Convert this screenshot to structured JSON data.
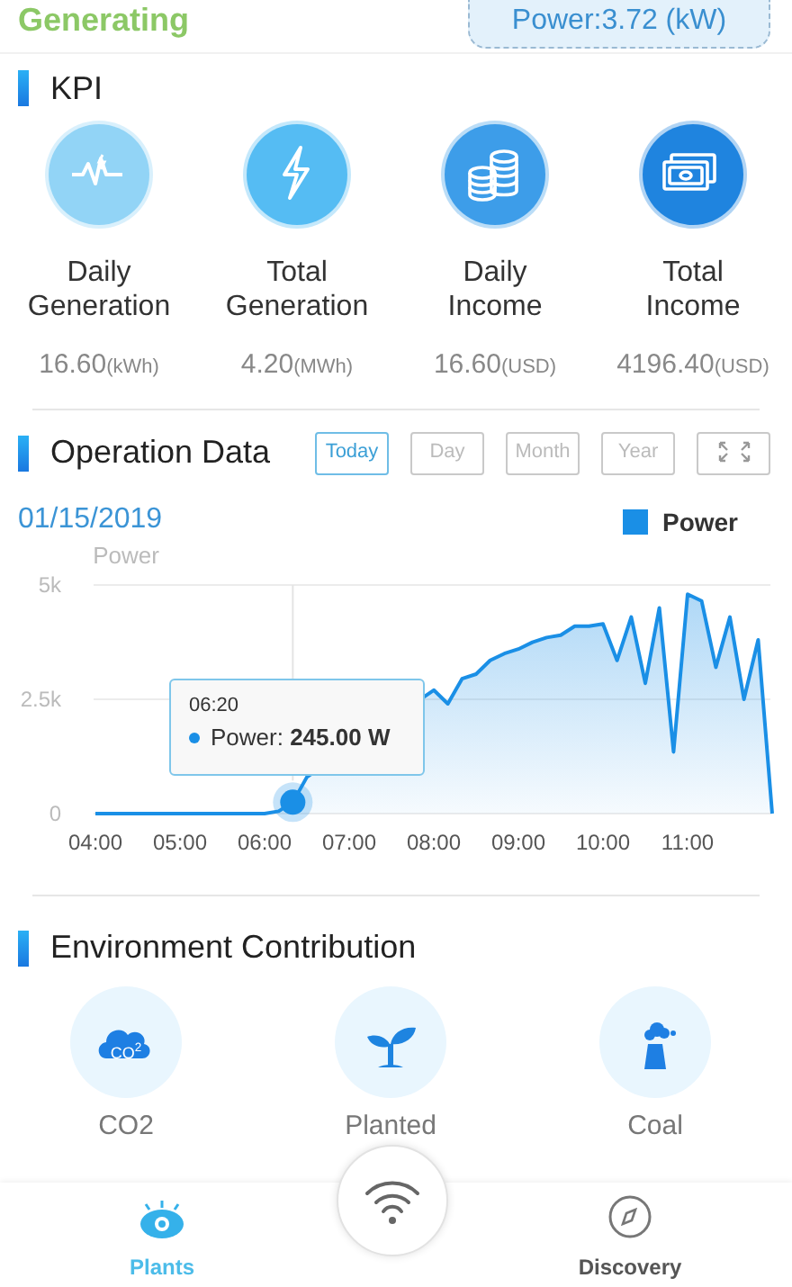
{
  "header": {
    "status": "Generating",
    "power": "Power:3.72 (kW)"
  },
  "kpi": {
    "title": "KPI",
    "items": [
      {
        "label": "Daily Generation",
        "value": "16.60",
        "unit": "(kWh)"
      },
      {
        "label": "Total Generation",
        "value": "4.20",
        "unit": "(MWh)"
      },
      {
        "label": "Daily Income",
        "value": "16.60",
        "unit": "(USD)"
      },
      {
        "label": "Total Income",
        "value": "4196.40",
        "unit": "(USD)"
      }
    ]
  },
  "operation": {
    "title": "Operation Data",
    "periods": [
      {
        "label": "Today",
        "selected": true
      },
      {
        "label": "Day",
        "selected": false
      },
      {
        "label": "Month",
        "selected": false
      },
      {
        "label": "Year",
        "selected": false
      }
    ],
    "date": "01/15/2019",
    "chart_data": {
      "type": "area",
      "ylabel": "Power",
      "x": [
        240,
        250,
        260,
        270,
        280,
        290,
        300,
        310,
        320,
        330,
        340,
        350,
        360,
        370,
        380,
        390,
        480,
        490,
        500,
        510,
        520,
        530,
        540,
        550,
        560,
        570,
        580,
        590,
        600,
        610,
        620,
        630,
        640,
        650,
        660,
        670,
        680,
        690,
        700,
        710,
        720
      ],
      "series": [
        {
          "name": "Power",
          "color": "#1a8fe6",
          "values": [
            0,
            0,
            0,
            0,
            0,
            0,
            0,
            0,
            0,
            0,
            0,
            0,
            0,
            50,
            250,
            800,
            2700,
            2400,
            2950,
            3050,
            3350,
            3500,
            3600,
            3750,
            3850,
            3900,
            4100,
            4100,
            4150,
            3350,
            4300,
            2850,
            4500,
            1350,
            4800,
            4650,
            3200,
            4300,
            2500,
            3800,
            0
          ]
        }
      ],
      "xlim": [
        240,
        720
      ],
      "ylim": [
        0,
        5000
      ],
      "yticks": [
        0,
        {
          "value": 2500,
          "label": "2.5k"
        },
        {
          "value": 5000,
          "label": "5k"
        }
      ],
      "ref_lines": [
        {
          "axis": "x",
          "value": 380
        }
      ],
      "xticks": [
        {
          "value": 240,
          "label": "04:00"
        },
        {
          "value": 300,
          "label": "05:00"
        },
        {
          "value": 360,
          "label": "06:00"
        },
        {
          "value": 420,
          "label": "07:00"
        },
        {
          "value": 480,
          "label": "08:00"
        },
        {
          "value": 540,
          "label": "09:00"
        },
        {
          "value": 600,
          "label": "10:00"
        },
        {
          "value": 660,
          "label": "11:00"
        }
      ]
    },
    "tooltip": {
      "time": "06:20",
      "text": "Power: **245.00 W**"
    }
  },
  "environment": {
    "title": "Environment Contribution",
    "items": [
      {
        "badge": "CO$^{2}$",
        "label": "CO2"
      },
      {
        "label": "Planted"
      },
      {
        "label": "Coal"
      }
    ]
  },
  "nav": [
    {
      "label": "Plants",
      "selected": true
    },
    {
      "label": "Discovery",
      "selected": false
    }
  ]
}
